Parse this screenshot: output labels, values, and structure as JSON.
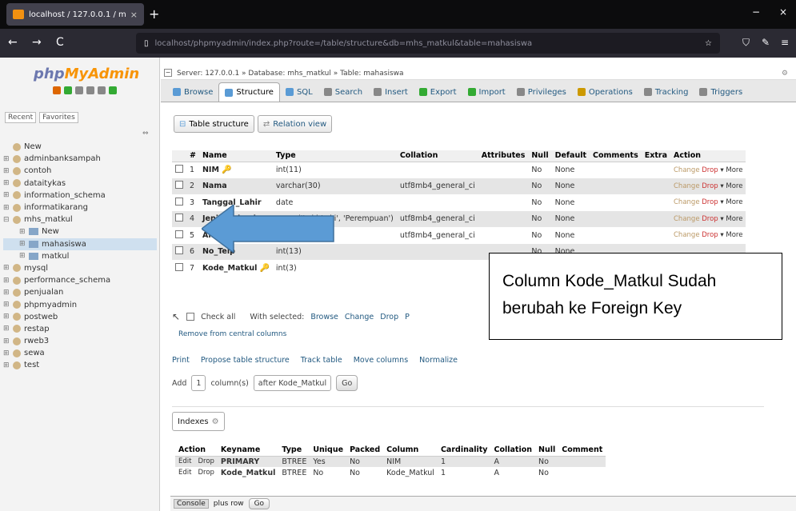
{
  "browser": {
    "tab_title": "localhost / 127.0.0.1 / mhs_matk",
    "tab_close": "×",
    "new_tab": "+",
    "url": "localhost/phpmyadmin/index.php?route=/table/structure&db=mhs_matkul&table=mahasiswa",
    "back": "←",
    "forward": "→",
    "reload": "C",
    "star": "☆",
    "window_min": "−",
    "window_close": "×"
  },
  "sidebar": {
    "logo_php": "php",
    "logo_mya": "MyAdmin",
    "recent": "Recent",
    "favorites": "Favorites",
    "collapse": "⇔",
    "items": [
      {
        "label": "New",
        "type": "new"
      },
      {
        "label": "adminbanksampah",
        "type": "db"
      },
      {
        "label": "contoh",
        "type": "db"
      },
      {
        "label": "dataitykas",
        "type": "db"
      },
      {
        "label": "information_schema",
        "type": "db"
      },
      {
        "label": "informatikarang",
        "type": "db"
      },
      {
        "label": "mhs_matkul",
        "type": "db"
      },
      {
        "label": "New",
        "type": "child"
      },
      {
        "label": "mahasiswa",
        "type": "child-sel"
      },
      {
        "label": "matkul",
        "type": "child"
      },
      {
        "label": "mysql",
        "type": "db"
      },
      {
        "label": "performance_schema",
        "type": "db"
      },
      {
        "label": "penjualan",
        "type": "db"
      },
      {
        "label": "phpmyadmin",
        "type": "db"
      },
      {
        "label": "postweb",
        "type": "db"
      },
      {
        "label": "restap",
        "type": "db"
      },
      {
        "label": "rweb3",
        "type": "db"
      },
      {
        "label": "sewa",
        "type": "db"
      },
      {
        "label": "test",
        "type": "db"
      }
    ]
  },
  "breadcrumb": {
    "text": "Server: 127.0.0.1 » Database: mhs_matkul » Table: mahasiswa",
    "settings": "⚙",
    "close": "⊼"
  },
  "tabs": [
    {
      "label": "Browse",
      "color": "#5a9bd5"
    },
    {
      "label": "Structure",
      "color": "#5a9bd5"
    },
    {
      "label": "SQL",
      "color": "#5a9bd5"
    },
    {
      "label": "Search",
      "color": "#888"
    },
    {
      "label": "Insert",
      "color": "#888"
    },
    {
      "label": "Export",
      "color": "#3a3"
    },
    {
      "label": "Import",
      "color": "#3a3"
    },
    {
      "label": "Privileges",
      "color": "#888"
    },
    {
      "label": "Operations",
      "color": "#c90"
    },
    {
      "label": "Tracking",
      "color": "#888"
    },
    {
      "label": "Triggers",
      "color": "#888"
    }
  ],
  "subtabs": {
    "table_structure": "Table structure",
    "relation_view": "Relation view"
  },
  "structure": {
    "headers": [
      "#",
      "Name",
      "Type",
      "Collation",
      "Attributes",
      "Null",
      "Default",
      "Comments",
      "Extra",
      "Action"
    ],
    "rows": [
      {
        "num": "1",
        "name": "NIM",
        "key": "🔑",
        "type": "int(11)",
        "collation": "",
        "null": "No",
        "default": "None"
      },
      {
        "num": "2",
        "name": "Nama",
        "key": "",
        "type": "varchar(30)",
        "collation": "utf8mb4_general_ci",
        "null": "No",
        "default": "None"
      },
      {
        "num": "3",
        "name": "Tanggal_Lahir",
        "key": "",
        "type": "date",
        "collation": "",
        "null": "No",
        "default": "None"
      },
      {
        "num": "4",
        "name": "Jenis_Kelamin",
        "key": "",
        "type": "enum('Laki-Laki', 'Perempuan')",
        "collation": "utf8mb4_general_ci",
        "null": "No",
        "default": "None"
      },
      {
        "num": "5",
        "name": "Alamat",
        "key": "",
        "type": "varchar(30)",
        "collation": "utf8mb4_general_ci",
        "null": "No",
        "default": "None"
      },
      {
        "num": "6",
        "name": "No_Telp",
        "key": "",
        "type": "int(13)",
        "collation": "",
        "null": "No",
        "default": "None"
      },
      {
        "num": "7",
        "name": "Kode_Matkul",
        "key": "🔑",
        "type": "int(3)",
        "collation": "",
        "null": "No",
        "default": "None"
      }
    ],
    "action_change": "Change",
    "action_drop": "Drop",
    "action_more": "▾ More"
  },
  "bulk": {
    "check_all": "Check all",
    "with_selected": "With selected:",
    "browse": "Browse",
    "change": "Change",
    "drop": "Drop",
    "primary": "P",
    "remove": "Remove from central columns"
  },
  "ops": {
    "print": "Print",
    "propose": "Propose table structure",
    "track": "Track table",
    "move": "Move columns",
    "normalize": "Normalize"
  },
  "addrow": {
    "add_label": "Add",
    "count": "1",
    "columns_label": "column(s)",
    "after": "after Kode_Matkul",
    "go": "Go"
  },
  "indexes": {
    "tab": "Indexes",
    "headers": [
      "Action",
      "Keyname",
      "Type",
      "Unique",
      "Packed",
      "Column",
      "Cardinality",
      "Collation",
      "Null",
      "Comment"
    ],
    "rows": [
      {
        "edit": "Edit",
        "drop": "Drop",
        "keyname": "PRIMARY",
        "type": "BTREE",
        "unique": "Yes",
        "packed": "No",
        "column": "NIM",
        "cardinality": "1",
        "collation": "A",
        "null": "No",
        "comment": ""
      },
      {
        "edit": "Edit",
        "drop": "Drop",
        "keyname": "Kode_Matkul",
        "type": "BTREE",
        "unique": "No",
        "packed": "No",
        "column": "Kode_Matkul",
        "cardinality": "1",
        "collation": "A",
        "null": "No",
        "comment": ""
      }
    ]
  },
  "console": {
    "label": "Console",
    "text": "plus row",
    "go": "Go"
  },
  "callout": {
    "line1": "Column Kode_Matkul Sudah",
    "line2": "berubah ke Foreign Key",
    "arrow_color": "#5b9bd5"
  }
}
